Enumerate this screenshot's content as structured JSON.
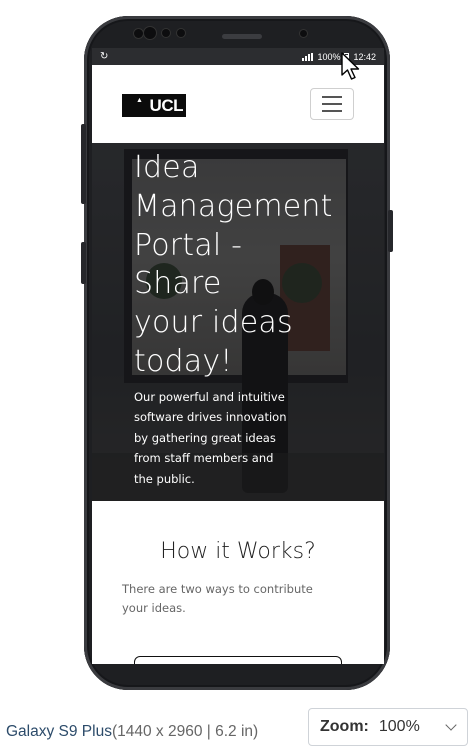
{
  "statusbar": {
    "battery": "100%",
    "time": "12:42"
  },
  "navbar": {
    "logo_text": "UCL"
  },
  "hero": {
    "title_lines": [
      "Idea",
      "Management",
      "Portal -",
      "Share",
      "your ideas",
      "today!"
    ],
    "subtitle_lines": [
      "Our powerful and intuitive",
      "software drives innovation",
      "by gathering great ideas",
      "from staff members and",
      "the public."
    ]
  },
  "how_it_works": {
    "title": "How it Works?",
    "text_lines": [
      "There are two ways to contribute",
      "your ideas."
    ]
  },
  "device": {
    "name": "Galaxy S9 Plus",
    "spec": "(1440 x 2960 | 6.2 in)"
  },
  "zoom": {
    "label": "Zoom:",
    "value": "100%"
  },
  "colors": {
    "phone_body": "#1e1f22",
    "device_name": "#2c4b6a"
  }
}
